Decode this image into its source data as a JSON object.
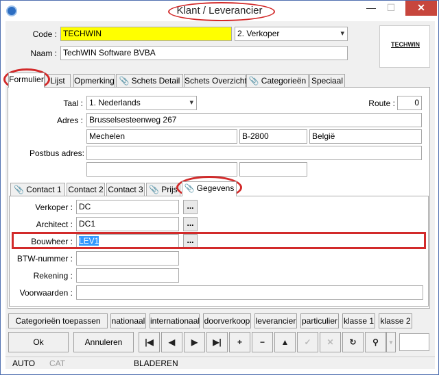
{
  "window": {
    "title": "Klant / Leverancier",
    "min_glyph": "—",
    "max_glyph": "☐",
    "close_glyph": "✕"
  },
  "header": {
    "code_label": "Code :",
    "code_value": "TECHWIN",
    "type_value": "2. Verkoper",
    "naam_label": "Naam :",
    "naam_value": "TechWIN Software BVBA",
    "logo_text": "TECHWIN"
  },
  "main_tabs": [
    {
      "label": "Formulier"
    },
    {
      "label": "Lijst"
    },
    {
      "label": "Opmerking"
    },
    {
      "label": "Schets Detail"
    },
    {
      "label": "Schets Overzicht"
    },
    {
      "label": "Categorieën"
    },
    {
      "label": "Speciaal"
    }
  ],
  "form": {
    "taal_label": "Taal :",
    "taal_value": "1.  Nederlands",
    "route_label": "Route :",
    "route_value": "0",
    "adres_label": "Adres :",
    "adres_street": "Brusselsesteenweg 267",
    "adres_city": "Mechelen",
    "adres_zip": "B-2800",
    "adres_country": "België",
    "postbus_label": "Postbus adres:"
  },
  "sub_tabs": [
    {
      "label": "Contact 1"
    },
    {
      "label": "Contact 2"
    },
    {
      "label": "Contact 3"
    },
    {
      "label": "Prijs"
    },
    {
      "label": "Gegevens"
    }
  ],
  "gegevens": {
    "verkoper_label": "Verkoper :",
    "verkoper_value": "DC",
    "architect_label": "Architect :",
    "architect_value": "DC1",
    "bouwheer_label": "Bouwheer :",
    "bouwheer_value": "LEV1",
    "btw_label": "BTW-nummer :",
    "rekening_label": "Rekening :",
    "voorwaarden_label": "Voorwaarden :",
    "dots": "..."
  },
  "categories_bar": {
    "apply_label": "Categorieën toepassen",
    "items": [
      "nationaal",
      "internationaal",
      "doorverkoop",
      "leverancier",
      "particulier",
      "klasse 1",
      "klasse 2"
    ]
  },
  "actions": {
    "ok_label": "Ok",
    "cancel_label": "Annuleren"
  },
  "status": {
    "mode": "AUTO",
    "cat": "CAT",
    "state": "BLADEREN"
  }
}
